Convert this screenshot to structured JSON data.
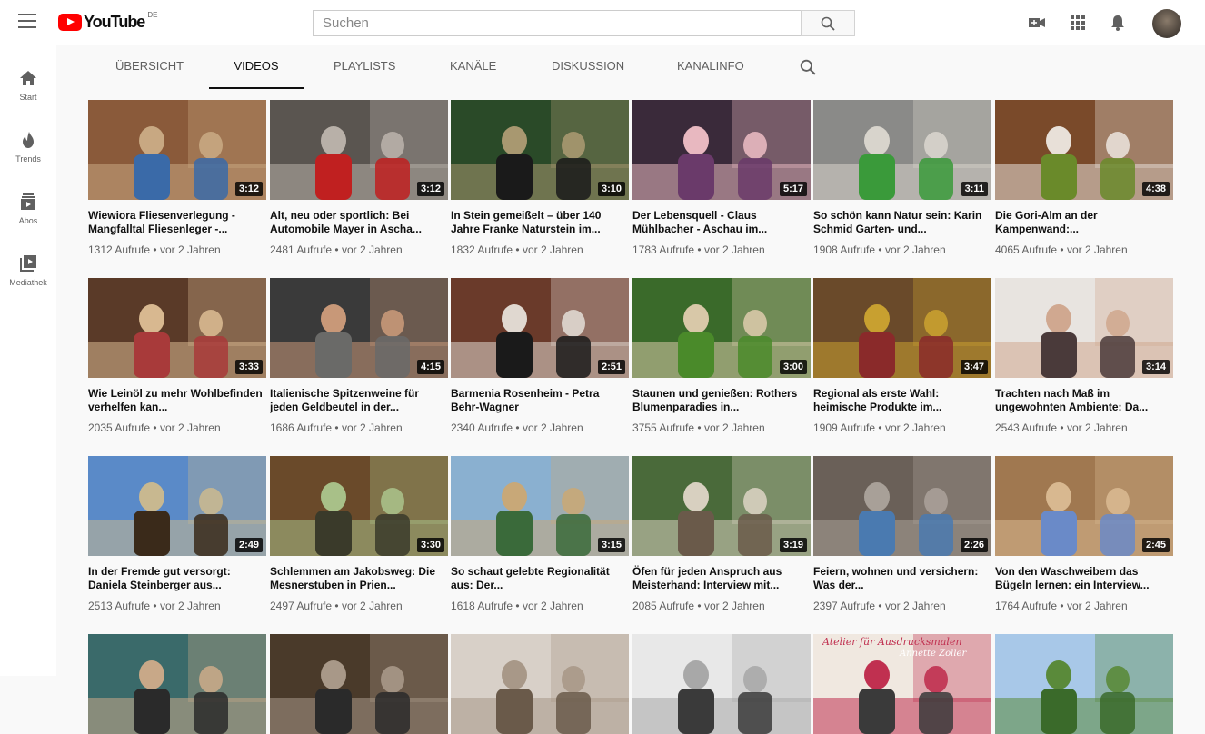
{
  "header": {
    "logo_text": "YouTube",
    "logo_country": "DE",
    "search_placeholder": "Suchen"
  },
  "sidebar": {
    "items": [
      {
        "label": "Start",
        "icon": "home-icon"
      },
      {
        "label": "Trends",
        "icon": "trending-icon"
      },
      {
        "label": "Abos",
        "icon": "subscriptions-icon"
      },
      {
        "label": "Mediathek",
        "icon": "library-icon"
      }
    ]
  },
  "tabs": [
    {
      "label": "ÜBERSICHT",
      "active": false
    },
    {
      "label": "VIDEOS",
      "active": true
    },
    {
      "label": "PLAYLISTS",
      "active": false
    },
    {
      "label": "KANÄLE",
      "active": false
    },
    {
      "label": "DISKUSSION",
      "active": false
    },
    {
      "label": "KANALINFO",
      "active": false
    }
  ],
  "videos": [
    {
      "title": "Wiewiora Fliesenverlegung - Mangfalltal Fliesenleger -...",
      "views": "1312 Aufrufe",
      "age": "vor 2 Jahren",
      "duration": "3:12",
      "colors": [
        "#8a5a3a",
        "#c8a882",
        "#3a6aa8"
      ]
    },
    {
      "title": "Alt, neu oder sportlich: Bei Automobile Mayer in Ascha...",
      "views": "2481 Aufrufe",
      "age": "vor 2 Jahren",
      "duration": "3:12",
      "colors": [
        "#5a5550",
        "#b8b0a8",
        "#c02020"
      ]
    },
    {
      "title": "In Stein gemeißelt – über 140 Jahre Franke Naturstein im...",
      "views": "1832 Aufrufe",
      "age": "vor 2 Jahren",
      "duration": "3:10",
      "colors": [
        "#2a4a28",
        "#a89870",
        "#1a1a1a"
      ]
    },
    {
      "title": "Der Lebensquell - Claus Mühlbacher - Aschau im...",
      "views": "1783 Aufrufe",
      "age": "vor 2 Jahren",
      "duration": "5:17",
      "colors": [
        "#3a2a3a",
        "#e8b8c0",
        "#6a3a6a"
      ]
    },
    {
      "title": "So schön kann Natur sein: Karin Schmid Garten- und...",
      "views": "1908 Aufrufe",
      "age": "vor 2 Jahren",
      "duration": "3:11",
      "colors": [
        "#8a8a88",
        "#d8d4cc",
        "#3a9a3a"
      ]
    },
    {
      "title": "Die Gori-Alm an der Kampenwand:...",
      "views": "4065 Aufrufe",
      "age": "vor 2 Jahren",
      "duration": "4:38",
      "colors": [
        "#7a4a2a",
        "#e8e0d8",
        "#6a8a2a"
      ]
    },
    {
      "title": "Wie Leinöl zu mehr Wohlbefinden verhelfen kan...",
      "views": "2035 Aufrufe",
      "age": "vor 2 Jahren",
      "duration": "3:33",
      "colors": [
        "#5a3a28",
        "#d8b890",
        "#a83a3a"
      ]
    },
    {
      "title": "Italienische Spitzenweine für jeden Geldbeutel in der...",
      "views": "1686 Aufrufe",
      "age": "vor 2 Jahren",
      "duration": "4:15",
      "colors": [
        "#3a3a3a",
        "#c89878",
        "#6a6a68"
      ]
    },
    {
      "title": "Barmenia Rosenheim - Petra Behr-Wagner",
      "views": "2340 Aufrufe",
      "age": "vor 2 Jahren",
      "duration": "2:51",
      "colors": [
        "#6a3a2a",
        "#e0d8d0",
        "#1a1a1a"
      ]
    },
    {
      "title": "Staunen und genießen: Rothers Blumenparadies in...",
      "views": "3755 Aufrufe",
      "age": "vor 2 Jahren",
      "duration": "3:00",
      "colors": [
        "#3a6a2a",
        "#d8c8a8",
        "#4a8a2a"
      ]
    },
    {
      "title": "Regional als erste Wahl: heimische Produkte im...",
      "views": "1909 Aufrufe",
      "age": "vor 2 Jahren",
      "duration": "3:47",
      "colors": [
        "#6a4a2a",
        "#c8a030",
        "#8a2a2a"
      ]
    },
    {
      "title": "Trachten nach Maß im ungewohnten Ambiente: Da...",
      "views": "2543 Aufrufe",
      "age": "vor 2 Jahren",
      "duration": "3:14",
      "colors": [
        "#e8e4e0",
        "#d0a890",
        "#4a3a3a"
      ]
    },
    {
      "title": "In der Fremde gut versorgt: Daniela Steinberger aus...",
      "views": "2513 Aufrufe",
      "age": "vor 2 Jahren",
      "duration": "2:49",
      "colors": [
        "#5a8ac8",
        "#c8b890",
        "#3a2a1a"
      ]
    },
    {
      "title": "Schlemmen am Jakobsweg: Die Mesnerstuben in Prien...",
      "views": "2497 Aufrufe",
      "age": "vor 2 Jahren",
      "duration": "3:30",
      "colors": [
        "#6a4a2a",
        "#a8c088",
        "#3a3a2a"
      ]
    },
    {
      "title": "So schaut gelebte Regionalität aus: Der...",
      "views": "1618 Aufrufe",
      "age": "vor 2 Jahren",
      "duration": "3:15",
      "colors": [
        "#8ab0d0",
        "#c8a878",
        "#3a6a3a"
      ]
    },
    {
      "title": "Öfen für jeden Anspruch aus Meisterhand: Interview mit...",
      "views": "2085 Aufrufe",
      "age": "vor 2 Jahren",
      "duration": "3:19",
      "colors": [
        "#4a6a3a",
        "#d8d0c0",
        "#6a5a4a"
      ]
    },
    {
      "title": "Feiern, wohnen und versichern: Was der...",
      "views": "2397 Aufrufe",
      "age": "vor 2 Jahren",
      "duration": "2:26",
      "colors": [
        "#6a6058",
        "#a8a098",
        "#4a7ab0"
      ]
    },
    {
      "title": "Von den Waschweibern das Bügeln lernen: ein Interview...",
      "views": "1764 Aufrufe",
      "age": "vor 2 Jahren",
      "duration": "2:45",
      "colors": [
        "#a07850",
        "#d8b890",
        "#6a8ac8"
      ]
    },
    {
      "title": "",
      "views": "",
      "age": "",
      "duration": "",
      "colors": [
        "#3a6a6a",
        "#c8a888",
        "#2a2a2a"
      ]
    },
    {
      "title": "",
      "views": "",
      "age": "",
      "duration": "",
      "colors": [
        "#4a3a2a",
        "#a89888",
        "#2a2a2a"
      ]
    },
    {
      "title": "",
      "views": "",
      "age": "",
      "duration": "",
      "colors": [
        "#d8d0c8",
        "#a89888",
        "#6a5a4a"
      ]
    },
    {
      "title": "",
      "views": "",
      "age": "",
      "duration": "",
      "colors": [
        "#e8e8e8",
        "#a8a8a8",
        "#3a3a3a"
      ]
    },
    {
      "title": "",
      "views": "",
      "age": "",
      "duration": "",
      "colors": [
        "#f0e8e0",
        "#c03050",
        "#3a3a3a"
      ],
      "overlay_text": [
        "Atelier für Ausdrucksmalen",
        "Annette Zoller"
      ]
    },
    {
      "title": "",
      "views": "",
      "age": "",
      "duration": "",
      "colors": [
        "#a8c8e8",
        "#5a8a3a",
        "#3a6a2a"
      ]
    }
  ],
  "meta_separator": " • "
}
